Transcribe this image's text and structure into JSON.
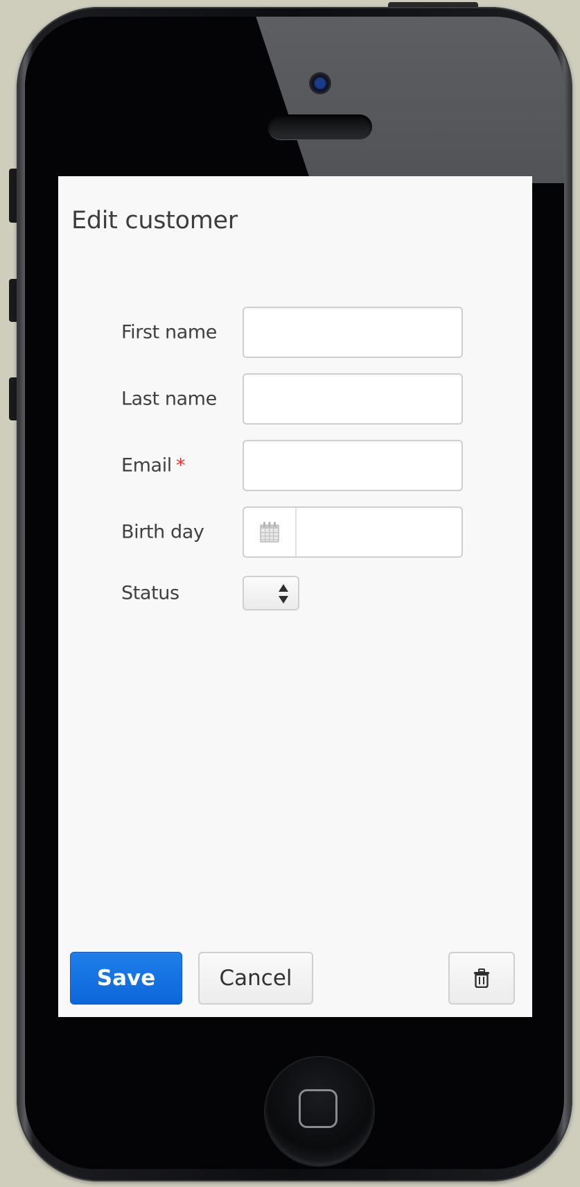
{
  "app": {
    "title": "Edit customer"
  },
  "form": {
    "first_name": {
      "label": "First name",
      "value": "",
      "placeholder": ""
    },
    "last_name": {
      "label": "Last name",
      "value": "",
      "placeholder": ""
    },
    "email": {
      "label": "Email",
      "required_mark": "*",
      "value": "",
      "placeholder": ""
    },
    "birth_day": {
      "label": "Birth day",
      "value": "",
      "icon": "calendar-icon"
    },
    "status": {
      "label": "Status",
      "value": "",
      "icon": "up-down-arrows-icon"
    }
  },
  "actions": {
    "save_label": "Save",
    "cancel_label": "Cancel",
    "delete_icon": "trash-icon"
  },
  "colors": {
    "primary": "#0f6fe0",
    "required": "#e0332f",
    "screen_bg": "#f8f8f8",
    "page_bg": "#cfcdbc"
  }
}
